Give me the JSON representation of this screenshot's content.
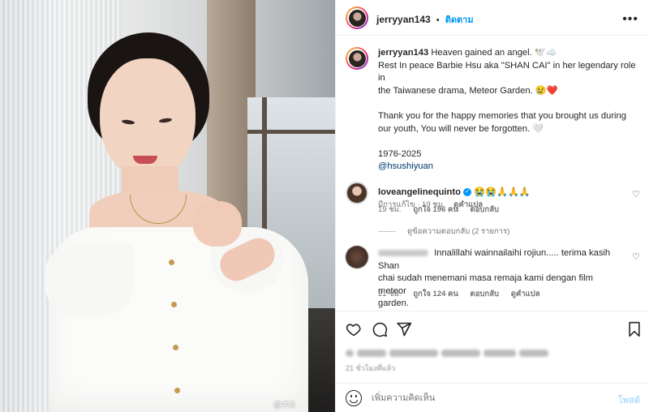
{
  "post_image": {
    "watermark": "@大S"
  },
  "header": {
    "username": "jerryyan143",
    "separator": "•",
    "follow_label": "ติดตาม",
    "more_icon": "more-horizontal-icon"
  },
  "caption": {
    "username": "jerryyan143",
    "lines": [
      "Heaven gained an angel. 🕊️☁️",
      "Rest In peace Barbie Hsu aka \"SHAN CAI\" in her legendary role in",
      "the Taiwanese drama, Meteor Garden. 😢❤️",
      "Thank you for the happy memories that you brought us during",
      "our youth, You will never be forgotten. 🤍",
      "1976-2025",
      "@hsushiyuan"
    ],
    "edited_time": "มีการแก้ไข · 19 ชม.",
    "translate_label": "ดูคำแปล"
  },
  "comments": [
    {
      "username": "loveangelinequinto",
      "verified": true,
      "text": "😭😭🙏🙏🙏",
      "time": "19 ชม.",
      "likes": "ถูกใจ 196 คน",
      "reply_label": "ตอบกลับ",
      "view_replies": "ดูข้อความตอบกลับ (2 รายการ)"
    },
    {
      "username_hidden": true,
      "text_lines": [
        "Innalillahi wainnailaihi rojiun..... terima kasih Shan",
        "chai sudah menemani masa remaja kami dengan film meteor",
        "garden."
      ],
      "time": "21 ชม.",
      "likes": "ถูกใจ 124 คน",
      "reply_label": "ตอบกลับ",
      "translate_label": "ดูคำแปล"
    }
  ],
  "actions": {
    "like_icon": "heart-icon",
    "comment_icon": "comment-icon",
    "share_icon": "send-icon",
    "save_icon": "bookmark-icon"
  },
  "footer": {
    "time_ago": "21 ชั่วโมงที่แล้ว",
    "comment_placeholder": "เพิ่มความคิดเห็น",
    "post_label": "โพสต์"
  },
  "colors": {
    "accent": "#0095f6",
    "text": "#262626",
    "muted": "#737373",
    "heart_red": "#ed4956"
  }
}
